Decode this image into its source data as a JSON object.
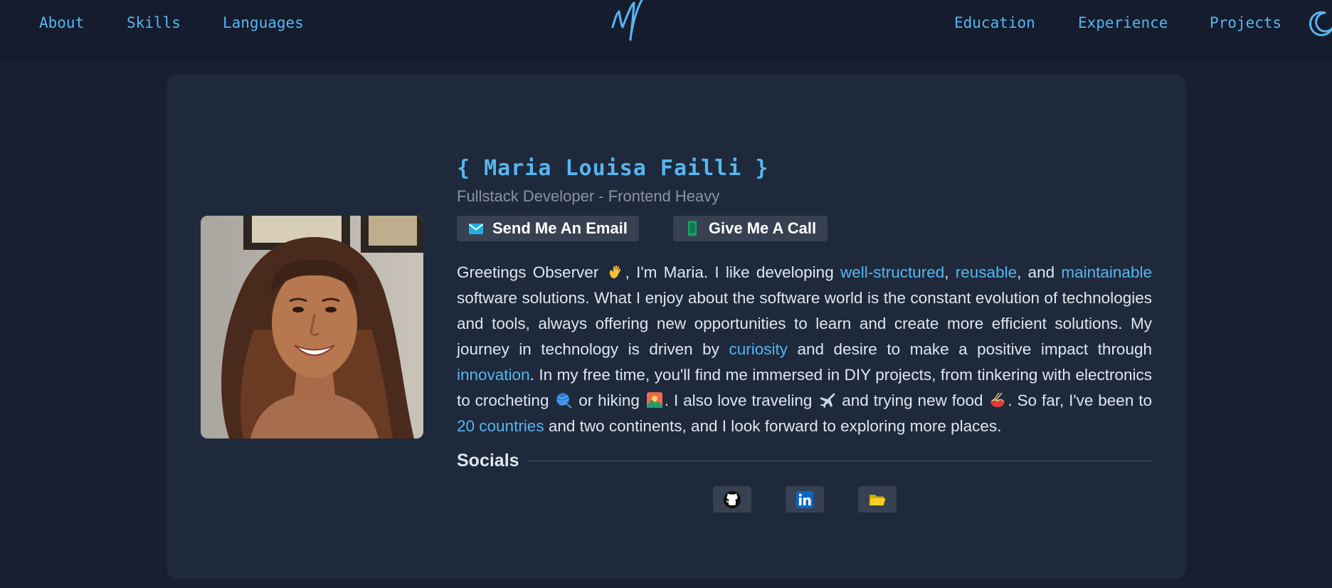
{
  "nav": {
    "left": [
      "About",
      "Skills",
      "Languages"
    ],
    "right": [
      "Education",
      "Experience",
      "Projects"
    ]
  },
  "profile": {
    "name": "{ Maria Louisa Failli }",
    "subtitle": "Fullstack Developer - Frontend Heavy",
    "email_label": "Send Me An Email",
    "call_label": "Give Me A Call"
  },
  "bio": {
    "p1": "Greetings Observer",
    "p2": ", I'm Maria. I like developing",
    "h1": "well-structured",
    "p3": ",",
    "h2": "reusable",
    "p4": ", and",
    "h3": "maintainable",
    "p5": "software solutions. What I enjoy about the software world is the constant evolution of technologies and tools, always offering new opportunities to learn and create more efficient solutions. My journey in technology is driven by",
    "h4": "curiosity",
    "p6": "and desire to make a positive impact through",
    "h5": "innovation",
    "p7": ". In my free time, you'll find me immersed in DIY projects, from tinkering with electronics to crocheting",
    "p8": "or hiking",
    "p9": ". I also love traveling",
    "p10": "and trying new food",
    "p11": ". So far, I've been to",
    "h6": "20 countries",
    "p12": "and two continents, and I look forward to exploring more places."
  },
  "socials": {
    "title": "Socials",
    "icons": [
      "github-icon",
      "linkedin-icon",
      "folder-icon"
    ]
  },
  "colors": {
    "accent": "#56b6f0",
    "background": "#172033",
    "card": "#1e293b",
    "button": "#374151"
  }
}
